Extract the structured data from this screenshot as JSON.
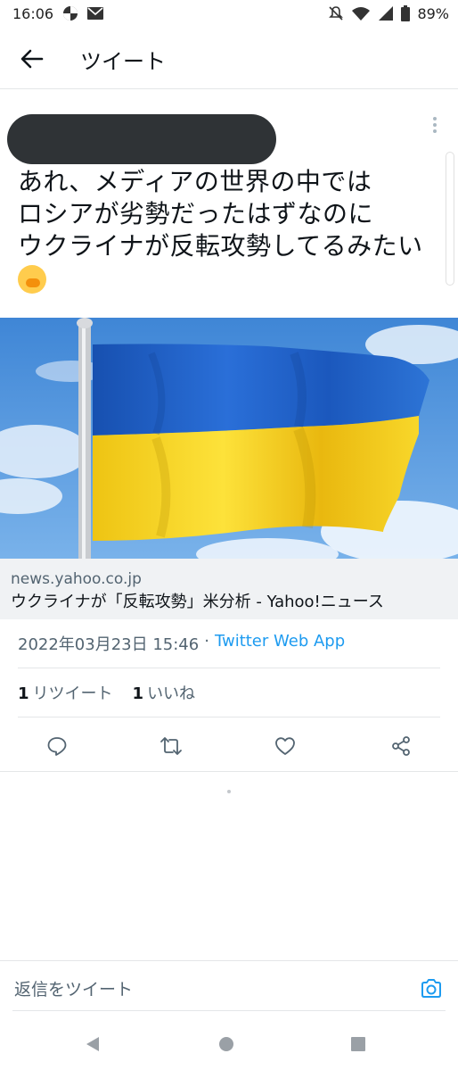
{
  "status_bar": {
    "time": "16:06",
    "battery": "89%"
  },
  "header": {
    "title": "ツイート"
  },
  "tweet": {
    "text": "あれ、メディアの世界の中では\nロシアが劣勢だったはずなのに\nウクライナが反転攻勢してるみたい",
    "emoji": "face-with-hand-over-mouth"
  },
  "card": {
    "domain": "news.yahoo.co.jp",
    "title": "ウクライナが「反転攻勢」米分析 - Yahoo!ニュース"
  },
  "timestamp": {
    "datetime": "2022年03月23日 15:46",
    "separator": "·",
    "client": "Twitter Web App"
  },
  "stats": {
    "retweets_count": "1",
    "retweets_label": "リツイート",
    "likes_count": "1",
    "likes_label": "いいね"
  },
  "reply": {
    "placeholder": "返信をツイート"
  },
  "colors": {
    "accent": "#1d9bf0",
    "flag_blue": "#1c5fc4",
    "flag_yellow": "#f6d21a"
  }
}
